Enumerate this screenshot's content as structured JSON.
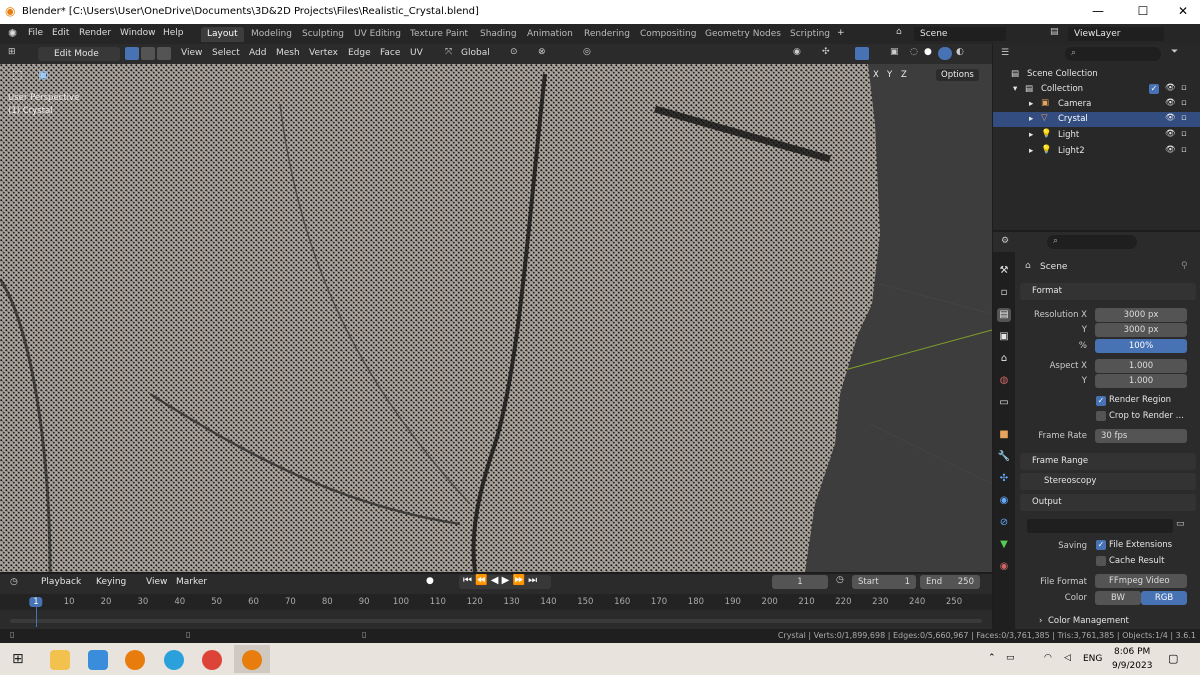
{
  "window": {
    "title": "Blender* [C:\\Users\\User\\OneDrive\\Documents\\3D&2D Projects\\Files\\Realistic_Crystal.blend]",
    "minimize": "—",
    "maximize": "☐",
    "close": "✕"
  },
  "menu": {
    "items": [
      "File",
      "Edit",
      "Render",
      "Window",
      "Help"
    ],
    "workspaces": [
      "Layout",
      "Modeling",
      "Sculpting",
      "UV Editing",
      "Texture Paint",
      "Shading",
      "Animation",
      "Rendering",
      "Compositing",
      "Geometry Nodes",
      "Scripting"
    ],
    "add_tab": "+",
    "scene": "Scene",
    "view_layer": "ViewLayer"
  },
  "viewport_header": {
    "mode": "Edit Mode",
    "menus": [
      "View",
      "Select",
      "Add",
      "Mesh",
      "Vertex",
      "Edge",
      "Face",
      "UV"
    ],
    "orientation": "Global"
  },
  "viewport": {
    "view_name": "User Perspective",
    "object_label": "(1) Crystal",
    "options": "Options",
    "axes": [
      "X",
      "Y",
      "Z"
    ]
  },
  "outliner": {
    "root": "Scene Collection",
    "collection": "Collection",
    "objects": [
      {
        "name": "Camera",
        "icon": "camera-icon"
      },
      {
        "name": "Crystal",
        "icon": "mesh-icon",
        "selected": true
      },
      {
        "name": "Light",
        "icon": "light-icon"
      },
      {
        "name": "Light2",
        "icon": "light-icon"
      }
    ]
  },
  "properties": {
    "context": "Scene",
    "format": {
      "title": "Format",
      "res_x_label": "Resolution X",
      "res_x": "3000 px",
      "res_y_label": "Y",
      "res_y": "3000 px",
      "pct_label": "%",
      "pct": "100%",
      "aspect_x_label": "Aspect X",
      "aspect_x": "1.000",
      "aspect_y_label": "Y",
      "aspect_y": "1.000",
      "render_region": "Render Region",
      "crop": "Crop to Render ...",
      "frame_rate_label": "Frame Rate",
      "frame_rate": "30 fps"
    },
    "frame_range": "Frame Range",
    "stereoscopy": "Stereoscopy",
    "output": {
      "title": "Output",
      "saving_label": "Saving",
      "file_ext": "File Extensions",
      "cache": "Cache Result",
      "file_format_label": "File Format",
      "file_format": "FFmpeg Video",
      "color_label": "Color",
      "bw": "BW",
      "rgb": "RGB",
      "color_mgmt": "Color Management"
    }
  },
  "timeline": {
    "menus": [
      "Playback",
      "Keying",
      "View",
      "Marker"
    ],
    "current_frame": "1",
    "start_label": "Start",
    "start": "1",
    "end_label": "End",
    "end": "250",
    "ticks": [
      "1",
      "10",
      "20",
      "30",
      "40",
      "50",
      "60",
      "70",
      "80",
      "90",
      "100",
      "110",
      "120",
      "130",
      "140",
      "150",
      "160",
      "170",
      "180",
      "190",
      "200",
      "210",
      "220",
      "230",
      "240",
      "250"
    ]
  },
  "status": {
    "text": "Crystal | Verts:0/1,899,698 | Edges:0/5,660,967 | Faces:0/3,761,385 | Tris:3,761,385 | Objects:1/4 | 3.6.1"
  },
  "taskbar": {
    "lang": "ENG",
    "time": "8:06 PM",
    "date": "9/9/2023"
  }
}
